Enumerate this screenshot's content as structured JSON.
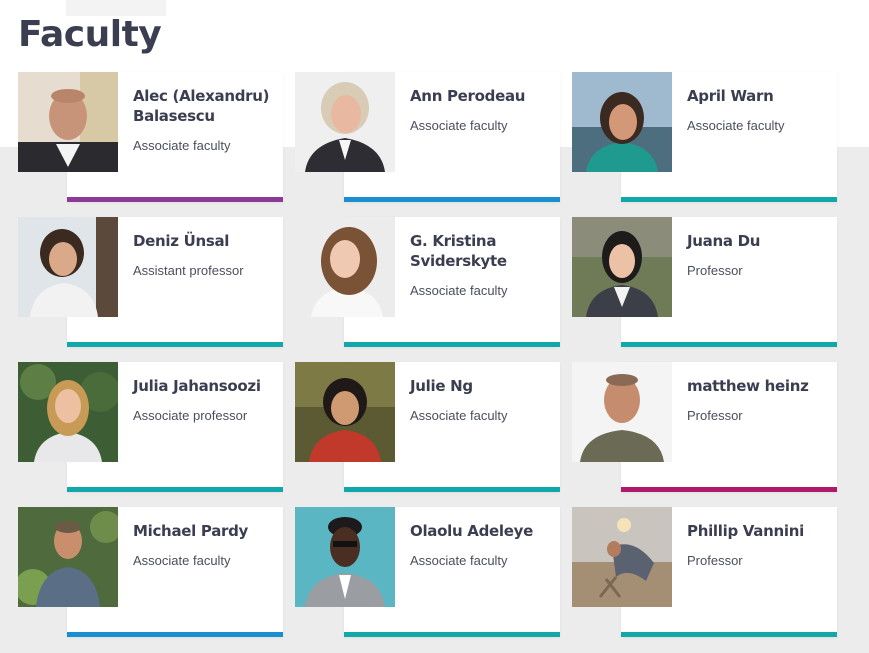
{
  "page": {
    "title": "Faculty"
  },
  "colors": {
    "purple": "#8b3a96",
    "blue": "#1a8fd0",
    "teal": "#12a7a9",
    "magenta": "#b0186a"
  },
  "faculty": [
    {
      "name": "Alec (Alexandru) Balasescu",
      "role": "Associate faculty",
      "bar_color": "#8b3a96"
    },
    {
      "name": "Ann Perodeau",
      "role": "Associate faculty",
      "bar_color": "#1a8fd0"
    },
    {
      "name": "April Warn",
      "role": "Associate faculty",
      "bar_color": "#12a7a9"
    },
    {
      "name": "Deniz Ünsal",
      "role": "Assistant professor",
      "bar_color": "#12a7a9"
    },
    {
      "name": "G. Kristina Sviderskyte",
      "role": "Associate faculty",
      "bar_color": "#12a7a9"
    },
    {
      "name": "Juana Du",
      "role": "Professor",
      "bar_color": "#12a7a9"
    },
    {
      "name": "Julia Jahansoozi",
      "role": "Associate professor",
      "bar_color": "#12a7a9"
    },
    {
      "name": "Julie Ng",
      "role": "Associate faculty",
      "bar_color": "#12a7a9"
    },
    {
      "name": "matthew heinz",
      "role": "Professor",
      "bar_color": "#b0186a"
    },
    {
      "name": "Michael Pardy",
      "role": "Associate faculty",
      "bar_color": "#1a8fd0"
    },
    {
      "name": "Olaolu Adeleye",
      "role": "Associate faculty",
      "bar_color": "#12a7a9"
    },
    {
      "name": "Phillip Vannini",
      "role": "Professor",
      "bar_color": "#12a7a9"
    }
  ]
}
